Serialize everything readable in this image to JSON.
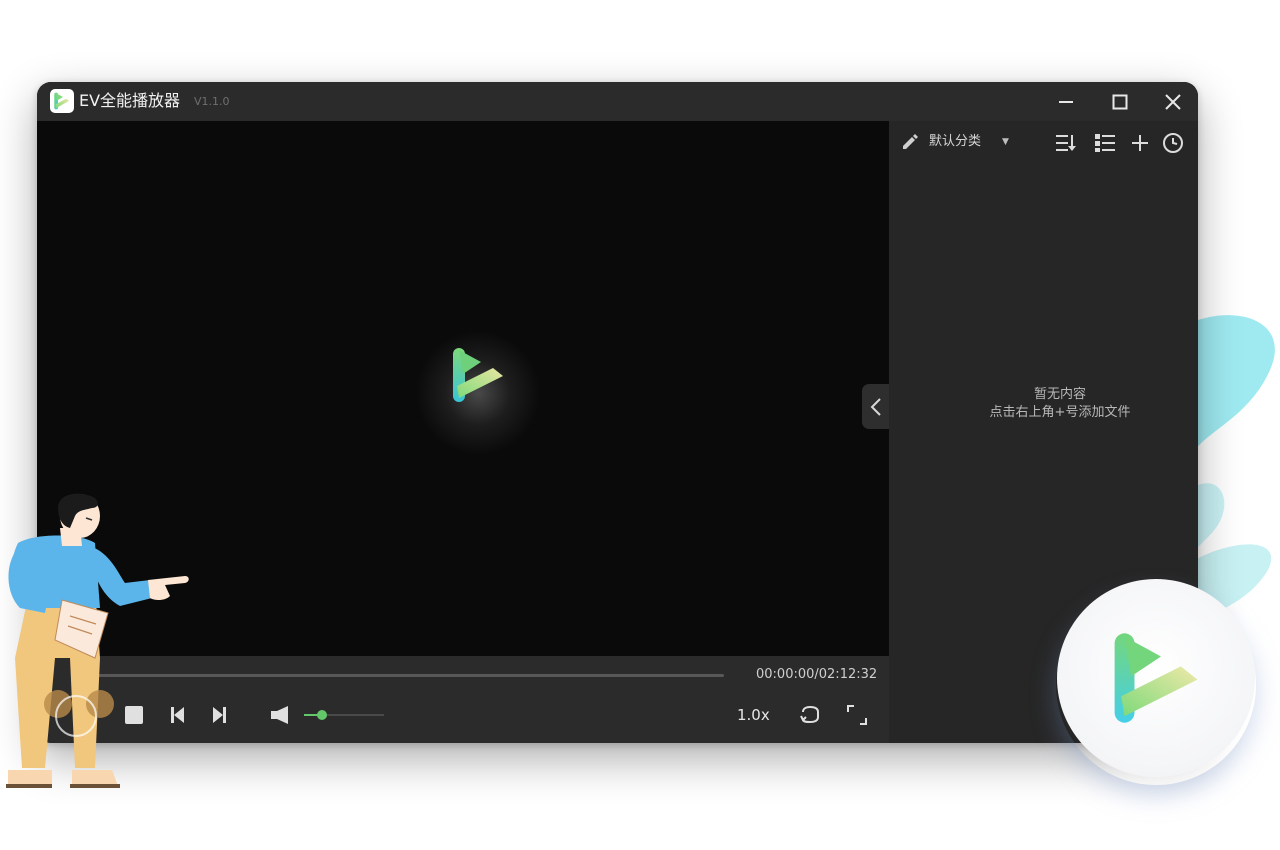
{
  "app": {
    "title": "EV全能播放器",
    "version": "V1.1.0"
  },
  "window_controls": {
    "minimize_icon": "minimize-icon",
    "maximize_icon": "maximize-icon",
    "close_icon": "close-icon"
  },
  "player": {
    "time": "00:00:00/02:12:32",
    "speed": "1.0x",
    "volume_level": 0.22,
    "progress": 0.0
  },
  "playlist": {
    "category": "默认分类",
    "empty_line1": "暂无内容",
    "empty_line2": "点击右上角+号添加文件"
  },
  "colors": {
    "accent_green": "#63c86a",
    "logo_teal": "#39c5d8",
    "logo_green": "#7ed97a",
    "logo_yellow": "#e7e6a0",
    "titlebar": "#2b2b2b",
    "panel": "#262626"
  }
}
